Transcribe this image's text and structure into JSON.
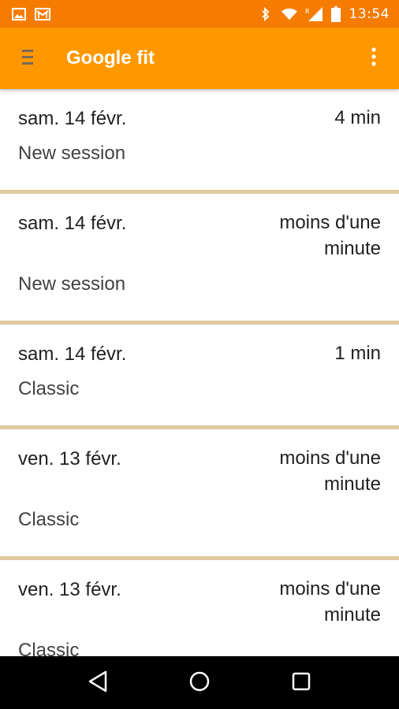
{
  "status_bar": {
    "time": "13:54",
    "icons": [
      "gallery-icon",
      "gmail-icon",
      "bluetooth-icon",
      "wifi-icon",
      "signal-roaming-icon",
      "battery-icon"
    ],
    "roaming_label": "R"
  },
  "app_bar": {
    "title": "Google fit",
    "menu_icon": "hamburger-icon",
    "overflow_icon": "more-vert-icon"
  },
  "sessions": [
    {
      "date": "sam. 14 févr.",
      "duration": "4 min",
      "type": "New session"
    },
    {
      "date": "sam. 14 févr.",
      "duration": "moins d'une minute",
      "type": "New session"
    },
    {
      "date": "sam. 14 févr.",
      "duration": "1 min",
      "type": "Classic"
    },
    {
      "date": "ven. 13 févr.",
      "duration": "moins d'une minute",
      "type": "Classic"
    },
    {
      "date": "ven. 13 févr.",
      "duration": "moins d'une minute",
      "type": "Classic"
    }
  ],
  "nav_bar": {
    "icons": [
      "back-icon",
      "home-icon",
      "recents-icon"
    ]
  },
  "colors": {
    "status_bar": "#f57c00",
    "app_bar": "#ff9800",
    "divider": "#e0c99e",
    "nav_bar": "#000000"
  }
}
